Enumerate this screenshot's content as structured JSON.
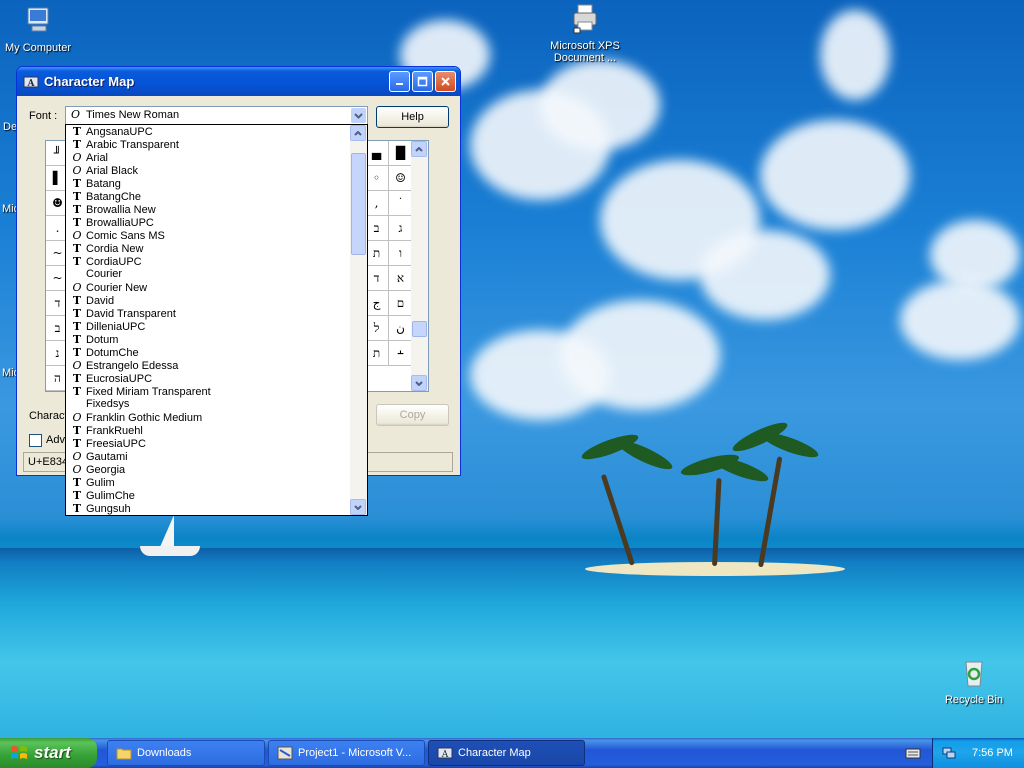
{
  "desktop": {
    "icons": [
      {
        "label": "My Computer"
      },
      {
        "label": "Microsoft XPS Document ..."
      },
      {
        "label": "Recycle Bin"
      }
    ],
    "edge_labels": [
      "De",
      "Mic",
      "Mic"
    ]
  },
  "window": {
    "title": "Character Map",
    "font_label": "Font :",
    "font_value": "Times New Roman",
    "help_button": "Help",
    "copy_button": "Copy",
    "chars_label": "Characte",
    "advanced_label": "Adv",
    "status_text": "U+E834"
  },
  "grid_visible_chars": [
    "▄",
    "█",
    "▐",
    "◦",
    "☺",
    "ﬁ",
    ",",
    "˙",
    "א",
    "ב",
    "ג",
    "ש",
    "ת",
    "ו",
    "ג",
    "ﬢ",
    "ﬡ",
    "ﬣ",
    "ج",
    "ﬦ",
    "ﬤ",
    "ﬥ",
    "ن",
    "ﬧ",
    "ﬨ",
    "﬩"
  ],
  "grid_left_chars": [
    "╜",
    "▌",
    "☻",
    ".",
    "~",
    "~",
    "ד",
    "ב",
    "נ",
    "ה"
  ],
  "font_list": [
    {
      "name": "AngsanaUPC",
      "type": "tt"
    },
    {
      "name": "Arabic Transparent",
      "type": "tt"
    },
    {
      "name": "Arial",
      "type": "ot"
    },
    {
      "name": "Arial Black",
      "type": "ot"
    },
    {
      "name": "Batang",
      "type": "tt"
    },
    {
      "name": "BatangChe",
      "type": "tt"
    },
    {
      "name": "Browallia New",
      "type": "tt"
    },
    {
      "name": "BrowalliaUPC",
      "type": "tt"
    },
    {
      "name": "Comic Sans MS",
      "type": "ot"
    },
    {
      "name": "Cordia New",
      "type": "tt"
    },
    {
      "name": "CordiaUPC",
      "type": "tt"
    },
    {
      "name": "Courier",
      "type": "none"
    },
    {
      "name": "Courier New",
      "type": "ot"
    },
    {
      "name": "David",
      "type": "tt"
    },
    {
      "name": "David Transparent",
      "type": "tt"
    },
    {
      "name": "DilleniaUPC",
      "type": "tt"
    },
    {
      "name": "Dotum",
      "type": "tt"
    },
    {
      "name": "DotumChe",
      "type": "tt"
    },
    {
      "name": "Estrangelo Edessa",
      "type": "ot"
    },
    {
      "name": "EucrosiaUPC",
      "type": "tt"
    },
    {
      "name": "Fixed Miriam Transparent",
      "type": "tt"
    },
    {
      "name": "Fixedsys",
      "type": "none"
    },
    {
      "name": "Franklin Gothic Medium",
      "type": "ot"
    },
    {
      "name": "FrankRuehl",
      "type": "tt"
    },
    {
      "name": "FreesiaUPC",
      "type": "tt"
    },
    {
      "name": "Gautami",
      "type": "ot"
    },
    {
      "name": "Georgia",
      "type": "ot"
    },
    {
      "name": "Gulim",
      "type": "tt"
    },
    {
      "name": "GulimChe",
      "type": "tt"
    },
    {
      "name": "Gungsuh",
      "type": "tt"
    }
  ],
  "taskbar": {
    "start_label": "start",
    "tasks": [
      {
        "label": "Downloads",
        "active": false
      },
      {
        "label": "Project1 - Microsoft V...",
        "active": false
      },
      {
        "label": "Character Map",
        "active": true
      }
    ],
    "clock": "7:56 PM"
  },
  "colors": {
    "titlebar": "#0553d6",
    "taskbar": "#245edb",
    "start_button": "#35a035",
    "window_bg": "#ece9d8"
  }
}
